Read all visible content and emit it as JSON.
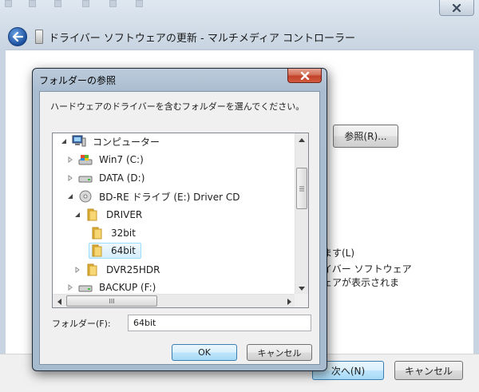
{
  "wizard": {
    "title": "ドライバー ソフトウェアの更新 - マルチメディア コントローラー",
    "browse_label": "参照(R)...",
    "text_line1": "ます(L)",
    "text_line2": "イバー ソフトウェア",
    "text_line3": "ェアが表示されま",
    "next_label": "次へ(N)",
    "cancel_label": "キャンセル"
  },
  "dialog": {
    "title": "フォルダーの参照",
    "instruction": "ハードウェアのドライバーを含むフォルダーを選んでください。",
    "tree": [
      {
        "label": "コンピューター",
        "icon": "computer-icon",
        "expander": "expanded"
      },
      {
        "label": "Win7 (C:)",
        "icon": "system-drive-icon",
        "expander": "collapsed"
      },
      {
        "label": "DATA (D:)",
        "icon": "hard-drive-icon",
        "expander": "collapsed"
      },
      {
        "label": "BD-RE ドライブ (E:) Driver CD",
        "icon": "optical-drive-icon",
        "expander": "expanded"
      },
      {
        "label": "DRIVER",
        "icon": "folder-icon",
        "expander": "expanded"
      },
      {
        "label": "32bit",
        "icon": "folder-icon",
        "expander": "none"
      },
      {
        "label": "64bit",
        "icon": "folder-icon",
        "expander": "none",
        "selected": true
      },
      {
        "label": "DVR25HDR",
        "icon": "folder-icon",
        "expander": "collapsed"
      },
      {
        "label": "BACKUP (F:)",
        "icon": "hard-drive-icon",
        "expander": "collapsed"
      }
    ],
    "hscroll_grip": "III",
    "folder_label": "フォルダー(F):",
    "folder_value": "64bit",
    "ok_label": "OK",
    "cancel_label": "キャンセル"
  },
  "colors": {
    "selection_fill": "#d5effc",
    "selection_border": "#99defd",
    "close_red": "#c2412a",
    "dialog_frame": "#a9bcd0"
  }
}
